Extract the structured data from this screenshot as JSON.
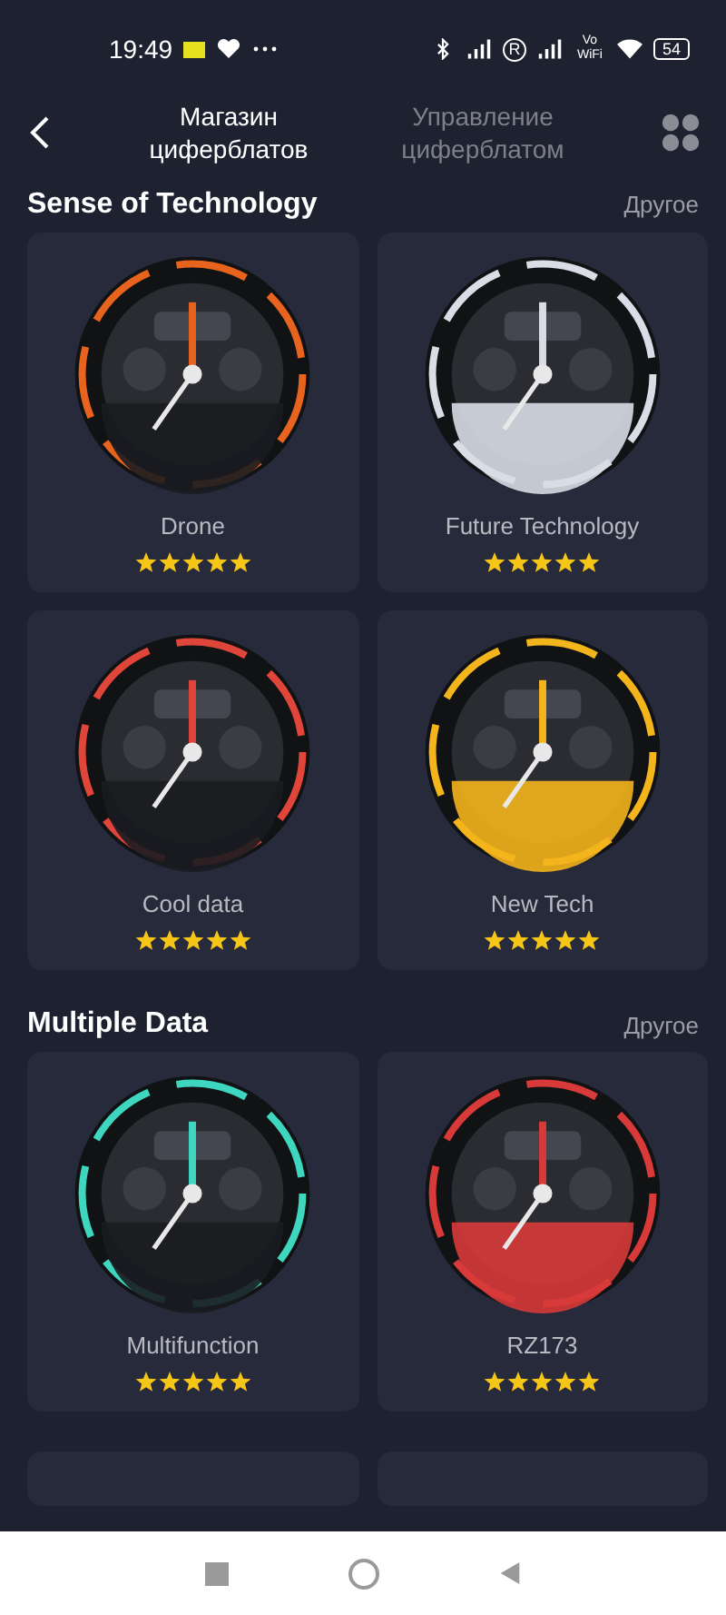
{
  "status_bar": {
    "time": "19:49",
    "roaming": "R",
    "vowifi": "Vo WiFi",
    "battery": "54"
  },
  "header": {
    "tabs": [
      {
        "label": "Магазин циферблатов",
        "selected": true
      },
      {
        "label": "Управление циферблатом",
        "selected": false
      }
    ]
  },
  "sections": [
    {
      "title": "Sense of Technology",
      "more": "Другое",
      "items": [
        {
          "name": "Drone",
          "stars": 5,
          "kind": "picture",
          "color": "#e8641e"
        },
        {
          "name": "Future Technology",
          "stars": 5,
          "kind": "picture",
          "color": "#d8dde6"
        },
        {
          "name": "Cool data",
          "stars": 5,
          "kind": "picture",
          "color": "#e0453a"
        },
        {
          "name": "New Tech",
          "stars": 5,
          "kind": "picture",
          "color": "#f4b41c"
        }
      ]
    },
    {
      "title": "Multiple Data",
      "more": "Другое",
      "items": [
        {
          "name": "Multifunction",
          "stars": 5,
          "kind": "picture",
          "color": "#3fd6c0"
        },
        {
          "name": "RZ173",
          "stars": 5,
          "kind": "picture",
          "color": "#d83a3a"
        }
      ]
    }
  ]
}
